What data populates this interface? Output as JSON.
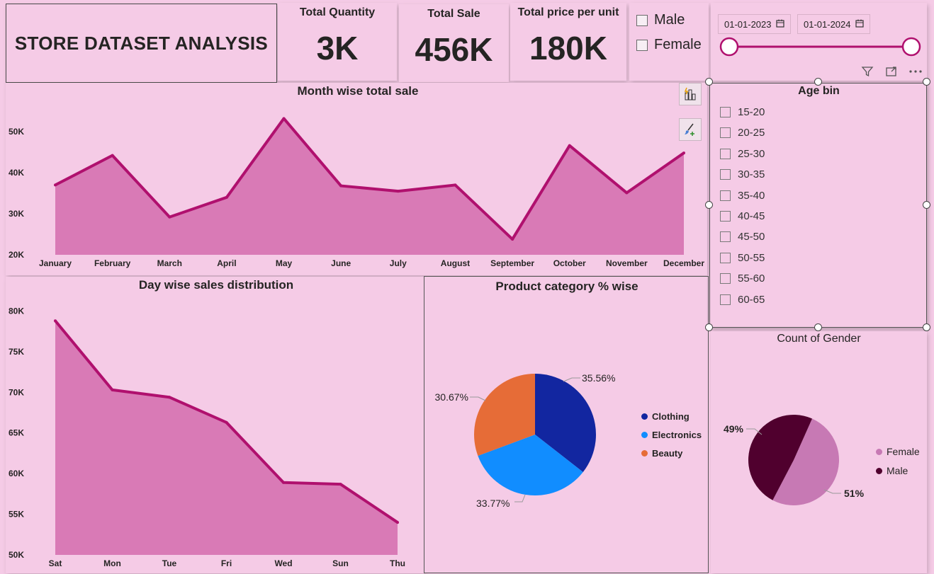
{
  "title": "STORE DATASET ANALYSIS",
  "kpis": [
    {
      "label": "Total Quantity",
      "value": "3K"
    },
    {
      "label": "Total Sale",
      "value": "456K"
    },
    {
      "label": "Total price per unit",
      "value": "180K"
    }
  ],
  "gender_slicer": {
    "options": [
      "Male",
      "Female"
    ]
  },
  "date_slicer": {
    "start": "01-01-2023",
    "end": "01-01-2024"
  },
  "age_bin": {
    "title": "Age bin",
    "options": [
      "15-20",
      "20-25",
      "25-30",
      "30-35",
      "35-40",
      "40-45",
      "45-50",
      "50-55",
      "55-60",
      "60-65"
    ]
  },
  "colors": {
    "accent": "#b0106e",
    "area_fill": "#d97ab6",
    "background": "#f5cbe6",
    "clothing": "#1226a0",
    "electronics": "#118dff",
    "beauty": "#e66c37",
    "female": "#c779b4",
    "male": "#50002e"
  },
  "icons": {
    "filter": "filter-icon",
    "focus": "focus-mode-icon",
    "more": "more-options-icon",
    "insights": "insights-icon",
    "format": "format-brush-icon",
    "calendar": "calendar-icon"
  },
  "chart_data": [
    {
      "type": "area",
      "title": "Month wise total sale",
      "categories": [
        "January",
        "February",
        "March",
        "April",
        "May",
        "June",
        "July",
        "August",
        "September",
        "October",
        "November",
        "December"
      ],
      "values": [
        37000,
        44200,
        29200,
        34000,
        53200,
        36800,
        35500,
        37000,
        23800,
        46600,
        35100,
        44800
      ],
      "ylim": [
        20000,
        55000
      ],
      "yticks": [
        "20K",
        "30K",
        "40K",
        "50K"
      ],
      "ytick_values": [
        20000,
        30000,
        40000,
        50000
      ],
      "grid": false
    },
    {
      "type": "area",
      "title": "Day wise sales distribution",
      "categories": [
        "Sat",
        "Mon",
        "Tue",
        "Fri",
        "Wed",
        "Sun",
        "Thu"
      ],
      "values": [
        78800,
        70300,
        69400,
        66300,
        58900,
        58700,
        54000
      ],
      "ylim": [
        50000,
        81000
      ],
      "yticks": [
        "50K",
        "55K",
        "60K",
        "65K",
        "70K",
        "75K",
        "80K"
      ],
      "ytick_values": [
        50000,
        55000,
        60000,
        65000,
        70000,
        75000,
        80000
      ],
      "grid": false
    },
    {
      "type": "pie",
      "title": "Product category % wise",
      "categories": [
        "Clothing",
        "Electronics",
        "Beauty"
      ],
      "values": [
        35.56,
        33.77,
        30.67
      ],
      "data_labels": [
        "35.56%",
        "33.77%",
        "30.67%"
      ],
      "legend": "right"
    },
    {
      "type": "pie",
      "title": "Count of Gender",
      "categories": [
        "Female",
        "Male"
      ],
      "values": [
        51,
        49
      ],
      "data_labels": [
        "51%",
        "49%"
      ],
      "legend": "right"
    }
  ]
}
